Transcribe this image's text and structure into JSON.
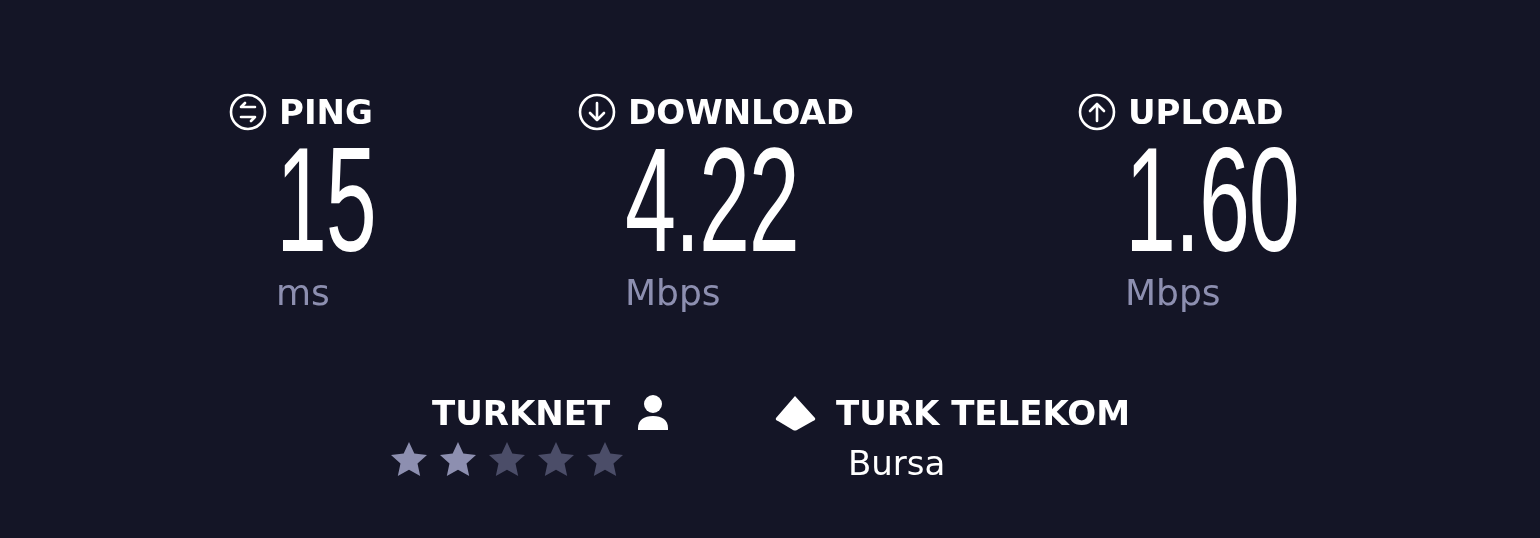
{
  "metrics": [
    {
      "kind": "ping",
      "label": "PING",
      "value": "15",
      "unit": "ms"
    },
    {
      "kind": "download",
      "label": "DOWNLOAD",
      "value": "4.22",
      "unit": "Mbps"
    },
    {
      "kind": "upload",
      "label": "UPLOAD",
      "value": "1.60",
      "unit": "Mbps"
    }
  ],
  "isp": {
    "name": "TURKNET",
    "stars": 2
  },
  "server": {
    "name": "TURK TELEKOM",
    "location": "Bursa"
  }
}
